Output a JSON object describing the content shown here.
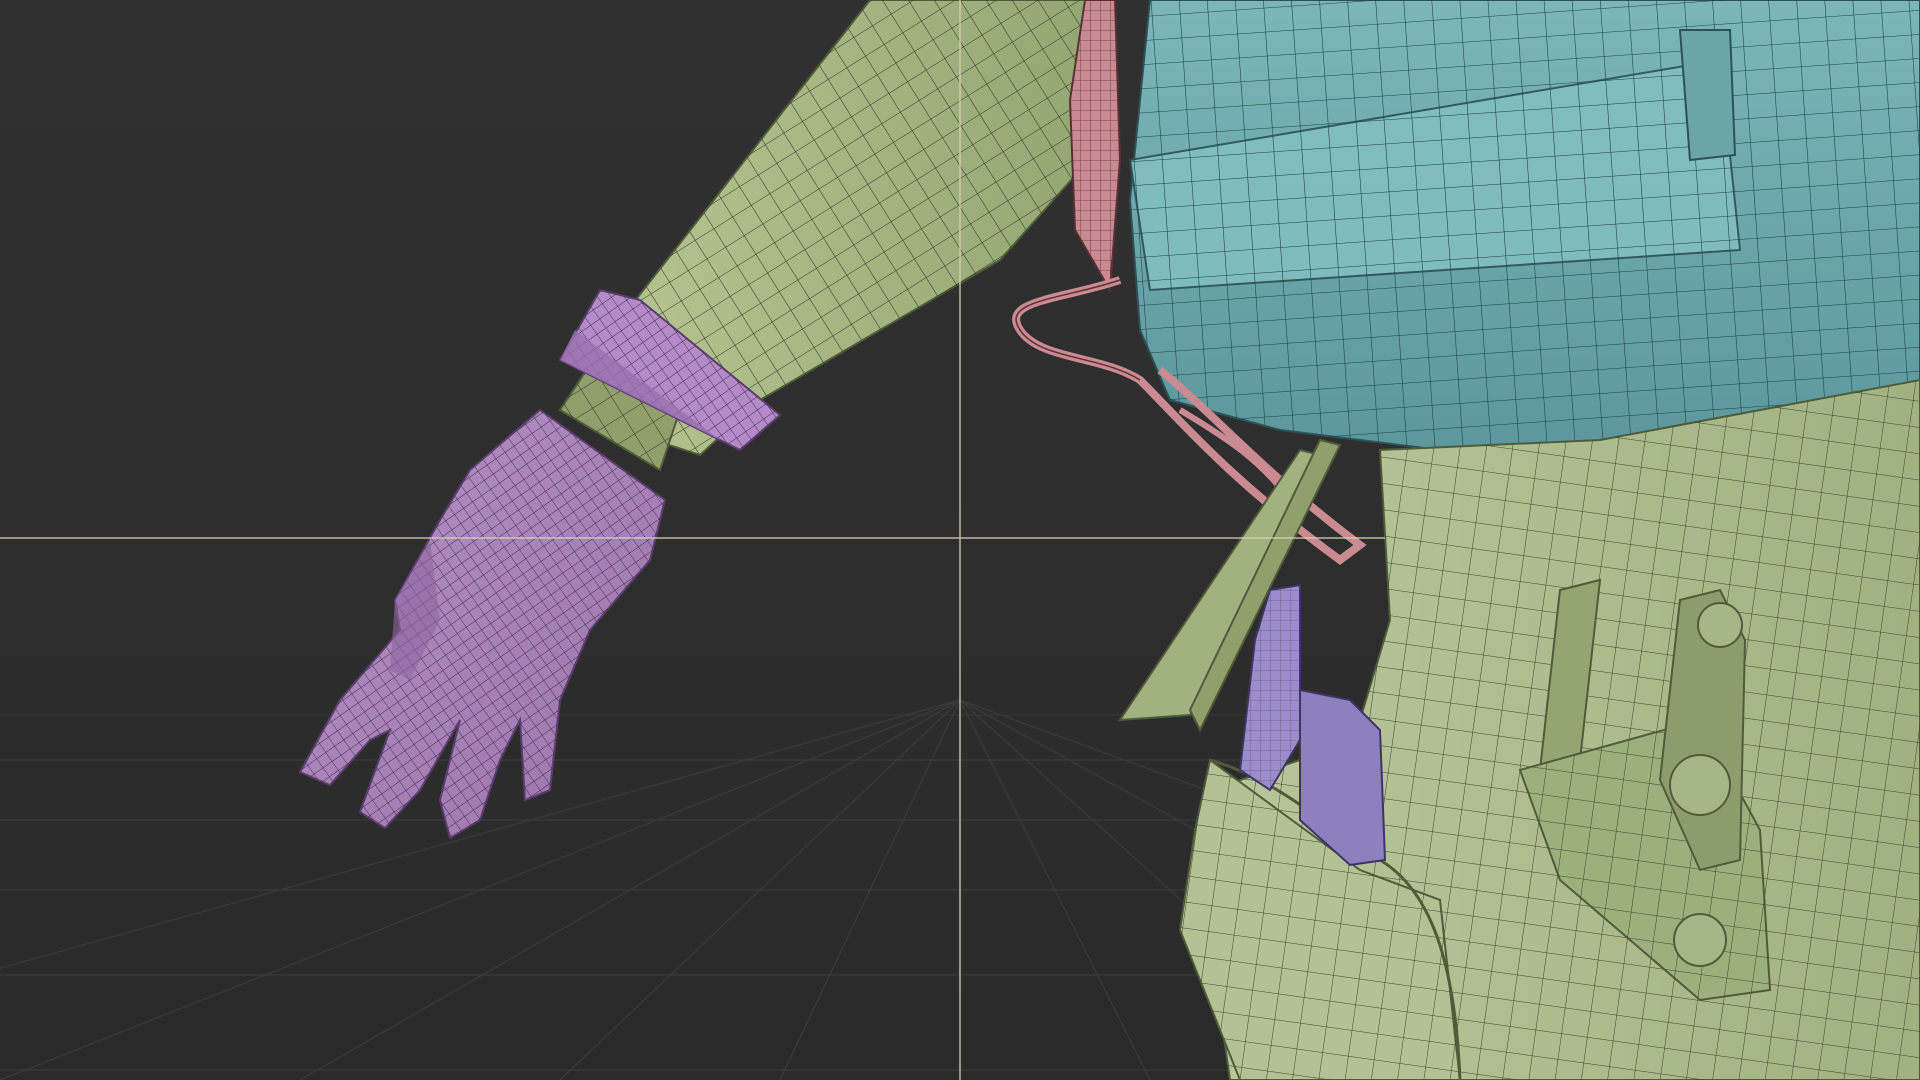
{
  "viewport": {
    "mode": "3d-modeling-viewport",
    "background": "#2d2d2d",
    "grid_color": "#3a3a3a",
    "cursor_crosshair_color": "#d9d2b4",
    "wireframe_overlay": true
  },
  "objects": [
    {
      "name": "sleeve",
      "color": "#9fb27f"
    },
    {
      "name": "glove",
      "color": "#a983b9"
    },
    {
      "name": "wristband",
      "color": "#b48ac8"
    },
    {
      "name": "backpack",
      "color": "#6fa8ad"
    },
    {
      "name": "strap",
      "color": "#c98a92"
    },
    {
      "name": "pants",
      "color": "#a9bb8a"
    },
    {
      "name": "knife-holster",
      "color": "#9b8ccc"
    }
  ]
}
